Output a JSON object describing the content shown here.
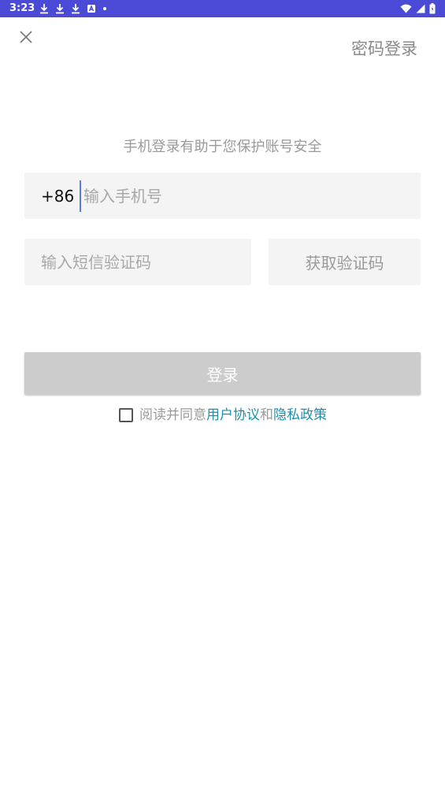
{
  "status_bar": {
    "time": "3:23",
    "background": "#4a4ad6"
  },
  "header": {
    "close_icon": "close-icon",
    "password_login_label": "密码登录"
  },
  "subtitle": "手机登录有助于您保护账号安全",
  "phone": {
    "country_code": "+86",
    "placeholder": "输入手机号",
    "value": ""
  },
  "sms_code": {
    "placeholder": "输入短信验证码",
    "value": "",
    "get_code_label": "获取验证码"
  },
  "login_button_label": "登录",
  "agreement": {
    "prefix": "阅读并同意",
    "user_agreement": "用户协议",
    "and": "和",
    "privacy_policy": "隐私政策",
    "checked": false,
    "link_color": "#1b8fb0"
  }
}
